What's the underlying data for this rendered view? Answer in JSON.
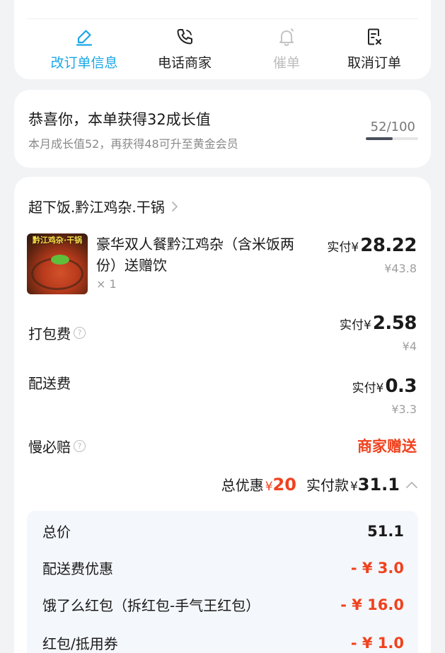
{
  "actions": [
    {
      "label": "改订单信息",
      "icon": "edit-icon",
      "state": "active"
    },
    {
      "label": "电话商家",
      "icon": "phone-icon",
      "state": "normal"
    },
    {
      "label": "催单",
      "icon": "bell-icon",
      "state": "disabled"
    },
    {
      "label": "取消订单",
      "icon": "cancel-doc-icon",
      "state": "normal"
    }
  ],
  "growth": {
    "title": "恭喜你，本单获得32成长值",
    "subtitle": "本月成长值52，再获得48可升至黄金会员",
    "progress_text": "52/100",
    "progress_fraction": 0.52
  },
  "order": {
    "shop_name": "超下饭.黔江鸡杂.干锅",
    "dish": {
      "image_banner": "黔江鸡杂·干锅",
      "name": "豪华双人餐黔江鸡杂（含米饭两份）送赠饮",
      "quantity": "× 1",
      "paid_label": "实付",
      "currency": "¥",
      "paid_amount": "28.22",
      "original": "¥43.8"
    },
    "packing_fee": {
      "label": "打包费",
      "paid_label": "实付",
      "currency": "¥",
      "paid_amount": "2.58",
      "original": "¥4"
    },
    "delivery_fee": {
      "label": "配送费",
      "paid_label": "实付",
      "currency": "¥",
      "paid_amount": "0.3",
      "original": "¥3.3"
    },
    "late_compensation": {
      "label": "慢必赔",
      "value": "商家赠送"
    },
    "totals": {
      "discount_label": "总优惠",
      "discount_currency": "¥",
      "discount_amount": "20",
      "pay_label": "实付款",
      "pay_currency": "¥",
      "pay_amount": "31.1"
    },
    "breakdown": [
      {
        "label": "总价",
        "value": "51.1"
      },
      {
        "label": "配送费优惠",
        "value": "- ¥ 3.0"
      },
      {
        "label": "饿了么红包（拆红包-手气王红包）",
        "value": "- ¥ 16.0"
      },
      {
        "label": "红包/抵用券",
        "value": "- ¥ 1.0"
      }
    ]
  },
  "colors": {
    "accent_blue": "#1aa7e6",
    "discount_red": "#f0421e",
    "disabled_gray": "#bdbdbd",
    "background": "#f2f3f5"
  }
}
